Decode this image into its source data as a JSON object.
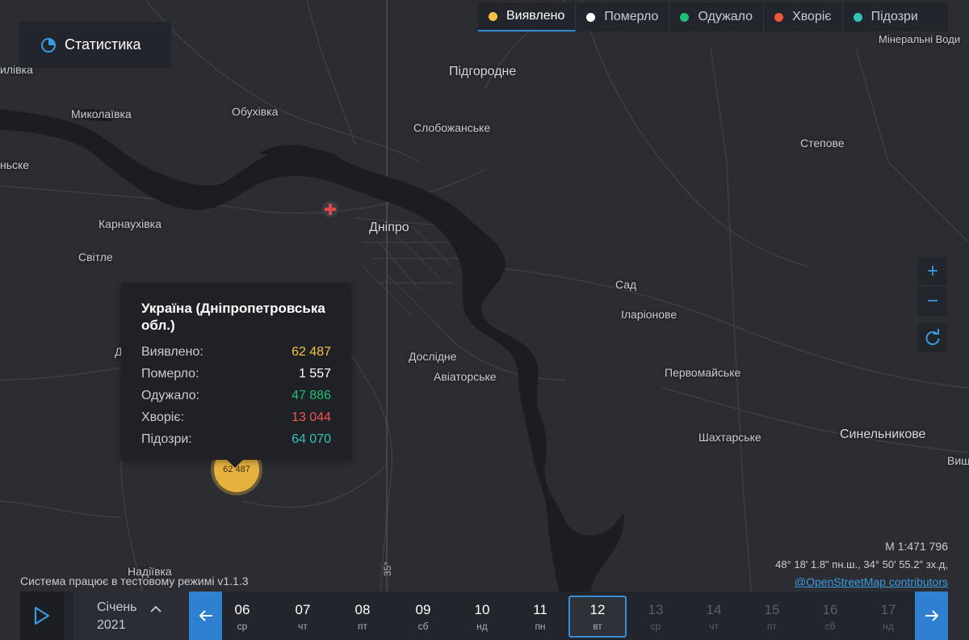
{
  "stats_button": {
    "label": "Статистика",
    "icon": "pie-chart-icon"
  },
  "legend": [
    {
      "label": "Виявлено",
      "color": "#f4c243",
      "active": true
    },
    {
      "label": "Померло",
      "color": "#ffffff",
      "active": false
    },
    {
      "label": "Одужало",
      "color": "#1fbf7a",
      "active": false
    },
    {
      "label": "Хворіє",
      "color": "#f0563c",
      "active": false
    },
    {
      "label": "Підозри",
      "color": "#35c3b5",
      "active": false
    }
  ],
  "places": {
    "pidhorodne": "Підгородне",
    "mykolaivka": "Миколаївка",
    "obukhivka": "Обухівка",
    "slobozhanske": "Слобожанське",
    "stepove": "Степове",
    "mineralni": "Мінеральні Води",
    "karnaukhivka": "Карнаухівка",
    "dnipro": "Дніпро",
    "svitle": "Світле",
    "sad": "Сад",
    "ilarionove": "Іларіонове",
    "doslidne": "Дослідне",
    "aviatorske": "Авіаторське",
    "pervomaiske": "Первомайське",
    "shakhtarske": "Шахтарське",
    "synelnykove": "Синельникове",
    "nadiivka": "Надіївка",
    "edge_left_1": "илівка",
    "edge_left_2": "ньске",
    "edge_left_3": "Д",
    "edge_right": "Виш"
  },
  "tooltip": {
    "title": "Україна (Дніпропетровська обл.)",
    "rows": [
      {
        "label": "Виявлено:",
        "value": "62 487",
        "color": "#f4c243"
      },
      {
        "label": "Померло:",
        "value": "1 557",
        "color": "#ffffff"
      },
      {
        "label": "Одужало:",
        "value": "47 886",
        "color": "#1fbf7a"
      },
      {
        "label": "Хворіє:",
        "value": "13 044",
        "color": "#f0564c"
      },
      {
        "label": "Підозри:",
        "value": "64 070",
        "color": "#35c3b5"
      }
    ]
  },
  "cluster": {
    "value": "62 487"
  },
  "map_info": {
    "scale": "М 1:471 796",
    "coords": "48° 18' 1.8\" пн.ш., 34° 50' 55.2\" зх.д,",
    "attribution": "@OpenStreetMap contributors",
    "meridian": "35°"
  },
  "system_message": "Система працює в тестовому режимі v1.1.3",
  "zoom": {
    "in": "+",
    "out": "−"
  },
  "timeline": {
    "month": "Січень",
    "year": "2021",
    "days": [
      {
        "n": "06",
        "w": "ср",
        "state": "normal"
      },
      {
        "n": "07",
        "w": "чт",
        "state": "normal"
      },
      {
        "n": "08",
        "w": "пт",
        "state": "normal"
      },
      {
        "n": "09",
        "w": "сб",
        "state": "normal"
      },
      {
        "n": "10",
        "w": "нд",
        "state": "normal"
      },
      {
        "n": "11",
        "w": "пн",
        "state": "normal"
      },
      {
        "n": "12",
        "w": "вт",
        "state": "selected"
      },
      {
        "n": "13",
        "w": "ср",
        "state": "dim"
      },
      {
        "n": "14",
        "w": "чт",
        "state": "dim"
      },
      {
        "n": "15",
        "w": "пт",
        "state": "dim"
      },
      {
        "n": "16",
        "w": "сб",
        "state": "dim"
      },
      {
        "n": "17",
        "w": "нд",
        "state": "dim"
      }
    ]
  }
}
